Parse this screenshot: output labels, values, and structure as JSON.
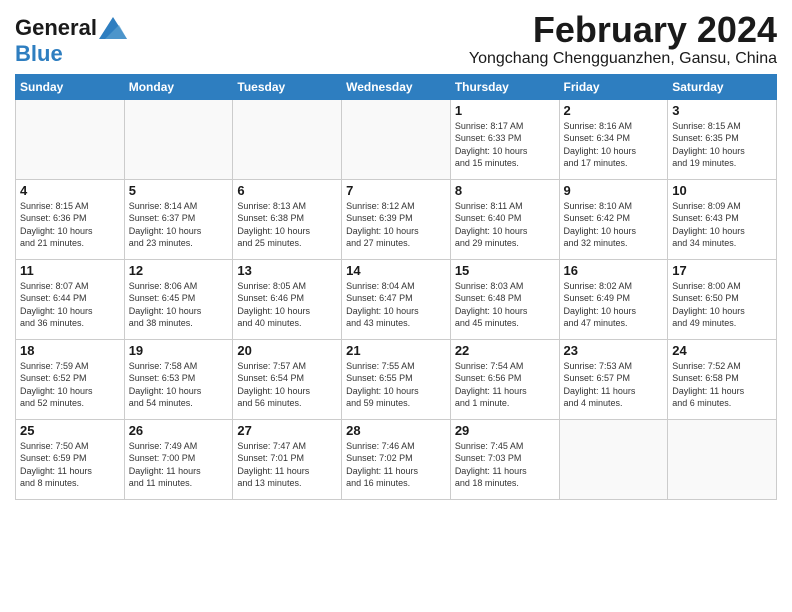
{
  "header": {
    "logo_general": "General",
    "logo_blue": "Blue",
    "title": "February 2024",
    "subtitle": "Yongchang Chengguanzhen, Gansu, China"
  },
  "days_of_week": [
    "Sunday",
    "Monday",
    "Tuesday",
    "Wednesday",
    "Thursday",
    "Friday",
    "Saturday"
  ],
  "weeks": [
    [
      {
        "day": "",
        "info": ""
      },
      {
        "day": "",
        "info": ""
      },
      {
        "day": "",
        "info": ""
      },
      {
        "day": "",
        "info": ""
      },
      {
        "day": "1",
        "info": "Sunrise: 8:17 AM\nSunset: 6:33 PM\nDaylight: 10 hours\nand 15 minutes."
      },
      {
        "day": "2",
        "info": "Sunrise: 8:16 AM\nSunset: 6:34 PM\nDaylight: 10 hours\nand 17 minutes."
      },
      {
        "day": "3",
        "info": "Sunrise: 8:15 AM\nSunset: 6:35 PM\nDaylight: 10 hours\nand 19 minutes."
      }
    ],
    [
      {
        "day": "4",
        "info": "Sunrise: 8:15 AM\nSunset: 6:36 PM\nDaylight: 10 hours\nand 21 minutes."
      },
      {
        "day": "5",
        "info": "Sunrise: 8:14 AM\nSunset: 6:37 PM\nDaylight: 10 hours\nand 23 minutes."
      },
      {
        "day": "6",
        "info": "Sunrise: 8:13 AM\nSunset: 6:38 PM\nDaylight: 10 hours\nand 25 minutes."
      },
      {
        "day": "7",
        "info": "Sunrise: 8:12 AM\nSunset: 6:39 PM\nDaylight: 10 hours\nand 27 minutes."
      },
      {
        "day": "8",
        "info": "Sunrise: 8:11 AM\nSunset: 6:40 PM\nDaylight: 10 hours\nand 29 minutes."
      },
      {
        "day": "9",
        "info": "Sunrise: 8:10 AM\nSunset: 6:42 PM\nDaylight: 10 hours\nand 32 minutes."
      },
      {
        "day": "10",
        "info": "Sunrise: 8:09 AM\nSunset: 6:43 PM\nDaylight: 10 hours\nand 34 minutes."
      }
    ],
    [
      {
        "day": "11",
        "info": "Sunrise: 8:07 AM\nSunset: 6:44 PM\nDaylight: 10 hours\nand 36 minutes."
      },
      {
        "day": "12",
        "info": "Sunrise: 8:06 AM\nSunset: 6:45 PM\nDaylight: 10 hours\nand 38 minutes."
      },
      {
        "day": "13",
        "info": "Sunrise: 8:05 AM\nSunset: 6:46 PM\nDaylight: 10 hours\nand 40 minutes."
      },
      {
        "day": "14",
        "info": "Sunrise: 8:04 AM\nSunset: 6:47 PM\nDaylight: 10 hours\nand 43 minutes."
      },
      {
        "day": "15",
        "info": "Sunrise: 8:03 AM\nSunset: 6:48 PM\nDaylight: 10 hours\nand 45 minutes."
      },
      {
        "day": "16",
        "info": "Sunrise: 8:02 AM\nSunset: 6:49 PM\nDaylight: 10 hours\nand 47 minutes."
      },
      {
        "day": "17",
        "info": "Sunrise: 8:00 AM\nSunset: 6:50 PM\nDaylight: 10 hours\nand 49 minutes."
      }
    ],
    [
      {
        "day": "18",
        "info": "Sunrise: 7:59 AM\nSunset: 6:52 PM\nDaylight: 10 hours\nand 52 minutes."
      },
      {
        "day": "19",
        "info": "Sunrise: 7:58 AM\nSunset: 6:53 PM\nDaylight: 10 hours\nand 54 minutes."
      },
      {
        "day": "20",
        "info": "Sunrise: 7:57 AM\nSunset: 6:54 PM\nDaylight: 10 hours\nand 56 minutes."
      },
      {
        "day": "21",
        "info": "Sunrise: 7:55 AM\nSunset: 6:55 PM\nDaylight: 10 hours\nand 59 minutes."
      },
      {
        "day": "22",
        "info": "Sunrise: 7:54 AM\nSunset: 6:56 PM\nDaylight: 11 hours\nand 1 minute."
      },
      {
        "day": "23",
        "info": "Sunrise: 7:53 AM\nSunset: 6:57 PM\nDaylight: 11 hours\nand 4 minutes."
      },
      {
        "day": "24",
        "info": "Sunrise: 7:52 AM\nSunset: 6:58 PM\nDaylight: 11 hours\nand 6 minutes."
      }
    ],
    [
      {
        "day": "25",
        "info": "Sunrise: 7:50 AM\nSunset: 6:59 PM\nDaylight: 11 hours\nand 8 minutes."
      },
      {
        "day": "26",
        "info": "Sunrise: 7:49 AM\nSunset: 7:00 PM\nDaylight: 11 hours\nand 11 minutes."
      },
      {
        "day": "27",
        "info": "Sunrise: 7:47 AM\nSunset: 7:01 PM\nDaylight: 11 hours\nand 13 minutes."
      },
      {
        "day": "28",
        "info": "Sunrise: 7:46 AM\nSunset: 7:02 PM\nDaylight: 11 hours\nand 16 minutes."
      },
      {
        "day": "29",
        "info": "Sunrise: 7:45 AM\nSunset: 7:03 PM\nDaylight: 11 hours\nand 18 minutes."
      },
      {
        "day": "",
        "info": ""
      },
      {
        "day": "",
        "info": ""
      }
    ]
  ]
}
